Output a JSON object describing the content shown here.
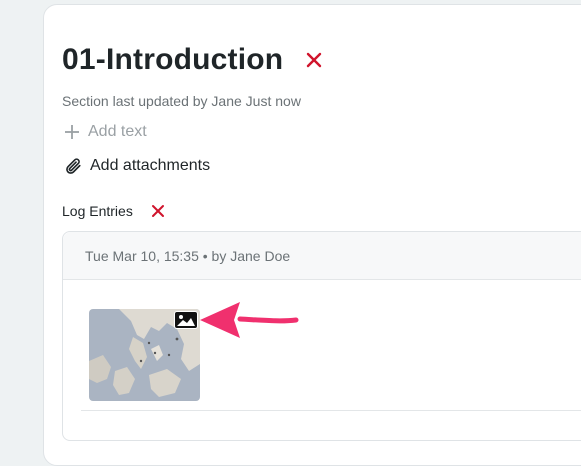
{
  "section": {
    "title": "01-Introduction",
    "updated_text": "Section last updated by Jane Just now"
  },
  "actions": {
    "add_text_label": "Add text",
    "add_attachments_label": "Add attachments"
  },
  "log": {
    "label": "Log Entries",
    "entries": [
      {
        "header": "Tue Mar 10, 15:35 • by Jane Doe",
        "attachment_icon": "image-icon"
      }
    ]
  },
  "colors": {
    "delete_red": "#d0142c",
    "annotation_arrow": "#f0306e"
  }
}
